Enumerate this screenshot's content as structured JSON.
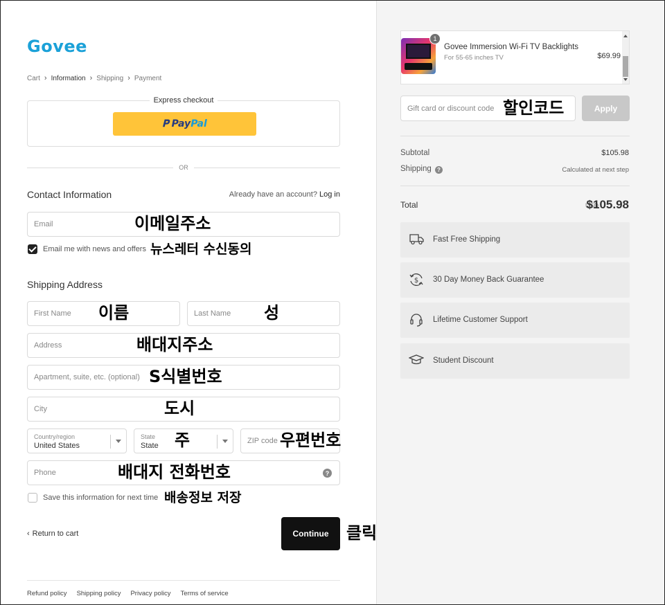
{
  "brand": {
    "logo": "Govee",
    "color": "#1ba1d8"
  },
  "breadcrumb": {
    "cart": "Cart",
    "information": "Information",
    "shipping": "Shipping",
    "payment": "Payment"
  },
  "express": {
    "title": "Express checkout",
    "paypal_left": "Pay",
    "paypal_right": "Pal"
  },
  "divider": {
    "or": "OR"
  },
  "contact": {
    "title": "Contact Information",
    "have_account": "Already have an account?",
    "login": "Log in",
    "email_placeholder": "Email",
    "email_anno": "이메일주소",
    "news_label": "Email me with news and offers",
    "news_checked": true,
    "news_anno": "뉴스레터 수신동의"
  },
  "shipping": {
    "title": "Shipping Address",
    "first_name_placeholder": "First Name",
    "first_name_anno": "이름",
    "last_name_placeholder": "Last Name",
    "last_name_anno": "성",
    "address_placeholder": "Address",
    "address_anno": "배대지주소",
    "apartment_placeholder": "Apartment, suite, etc. (optional)",
    "apartment_anno": "S식별번호",
    "city_placeholder": "City",
    "city_anno": "도시",
    "country_label": "Country/region",
    "country_value": "United States",
    "state_label": "State",
    "state_value": "State",
    "state_anno": "주",
    "zip_placeholder": "ZIP code",
    "zip_anno": "우편번호",
    "phone_placeholder": "Phone",
    "phone_anno": "배대지 전화번호",
    "save_label": "Save this information for next time",
    "save_checked": false,
    "save_anno": "배송정보 저장"
  },
  "actions": {
    "return": "Return to cart",
    "continue": "Continue",
    "continue_anno": "클릭"
  },
  "footer": {
    "refund": "Refund policy",
    "shipping": "Shipping policy",
    "privacy": "Privacy policy",
    "terms": "Terms of service"
  },
  "order": {
    "product_name": "Govee Immersion Wi-Fi TV Backlights",
    "product_variant": "For 55-65 inches TV",
    "product_price": "$69.99",
    "quantity": "1",
    "gift_placeholder": "Gift card or discount code",
    "gift_anno": "할인코드",
    "apply": "Apply",
    "subtotal_label": "Subtotal",
    "subtotal_value": "$105.98",
    "shipping_label": "Shipping",
    "shipping_value": "Calculated at next step",
    "total_label": "Total",
    "total_currency": "USD",
    "total_value": "$105.98"
  },
  "benefits": [
    {
      "icon": "truck-icon",
      "label": "Fast Free Shipping"
    },
    {
      "icon": "money-back-icon",
      "label": "30 Day Money Back Guarantee"
    },
    {
      "icon": "headset-icon",
      "label": "Lifetime Customer Support"
    },
    {
      "icon": "graduation-cap-icon",
      "label": "Student Discount"
    }
  ]
}
